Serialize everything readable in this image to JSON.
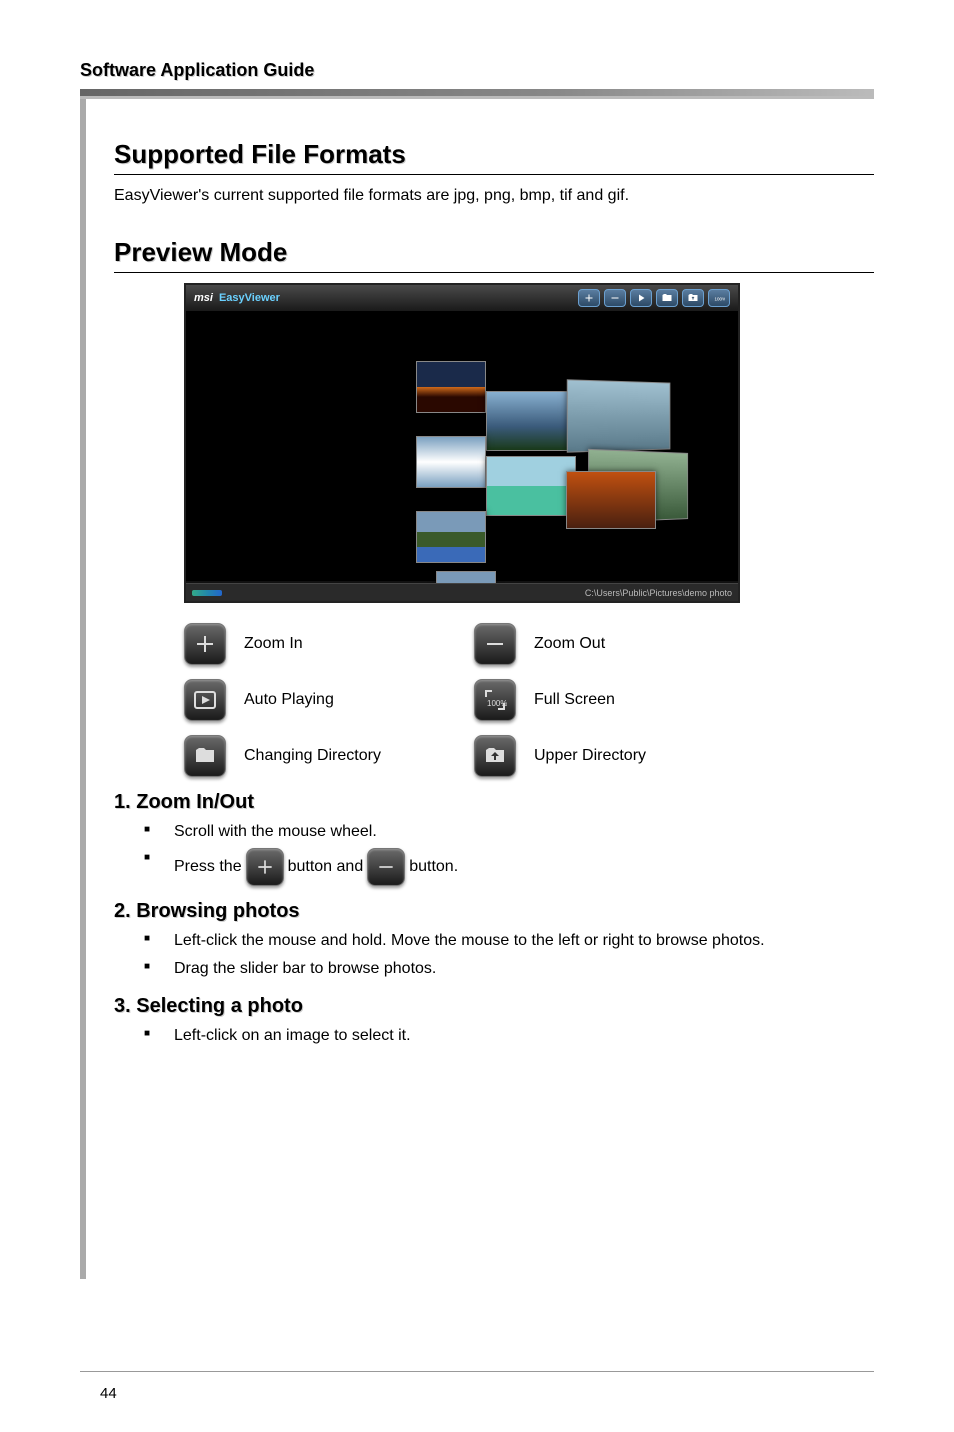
{
  "header": {
    "title": "Software Application Guide"
  },
  "section1": {
    "heading": "Supported File Formats",
    "body": "EasyViewer's current supported file formats are jpg, png, bmp, tif and gif."
  },
  "section2": {
    "heading": "Preview Mode"
  },
  "screenshot": {
    "brand": "msi",
    "app": "EasyViewer",
    "path": "C:\\Users\\Public\\Pictures\\demo photo"
  },
  "legend": {
    "zoom_in": "Zoom In",
    "zoom_out": "Zoom Out",
    "auto_playing": "Auto Playing",
    "full_screen": "Full Screen",
    "changing_directory": "Changing Directory",
    "upper_directory": "Upper Directory"
  },
  "instr1": {
    "heading": "1. Zoom In/Out",
    "b1": "Scroll with the mouse wheel.",
    "b2_pre": "Press the ",
    "b2_mid": " button and ",
    "b2_post": " button."
  },
  "instr2": {
    "heading": "2. Browsing photos",
    "b1": "Left-click the mouse and hold. Move the mouse to the left or right to browse photos.",
    "b2": "Drag the slider bar to browse photos."
  },
  "instr3": {
    "heading": "3. Selecting a photo",
    "b1": "Left-click on an image to select it."
  },
  "page_number": "44"
}
